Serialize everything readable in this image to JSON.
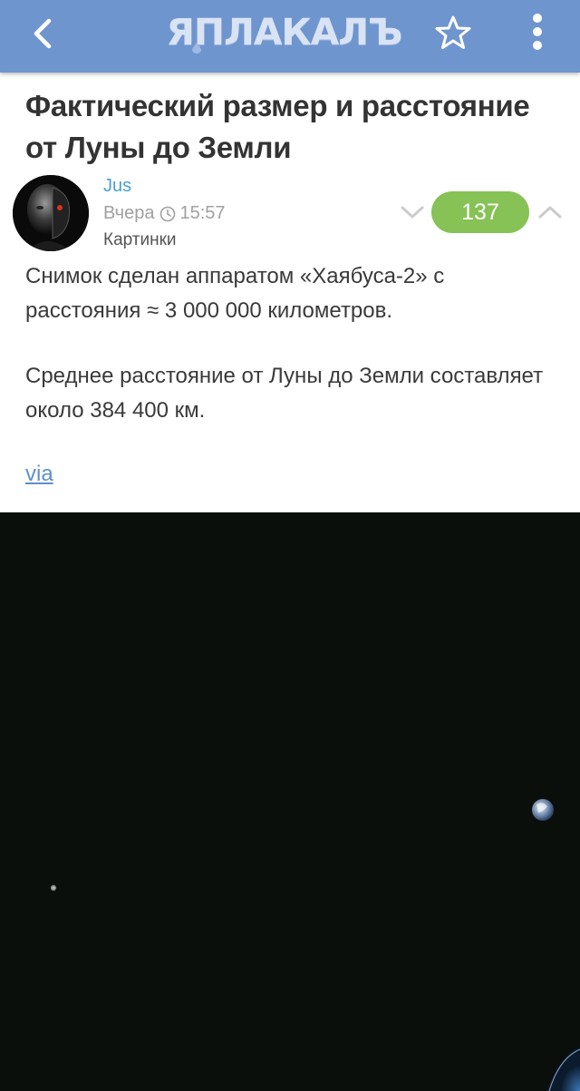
{
  "header": {
    "logo_text": "ЯПЛАКАЛЪ",
    "bar_color": "#6f95cf",
    "back_icon": "chevron-left-icon",
    "favorite_icon": "star-outline-icon",
    "menu_icon": "more-vertical-icon"
  },
  "post": {
    "title": "Фактический размер и расстояние от Луны до Земли",
    "author": "Jus",
    "date": "Вчера",
    "time": "15:57",
    "category": "Картинки",
    "rating": "137",
    "rating_color": "#86c255",
    "paragraphs": [
      "Снимок сделан аппаратом «Хаябуса-2» с расстояния ≈ 3 000 000 километров.",
      "Среднее расстояние от Луны до Земли составляет около 384 400 км."
    ],
    "via_label": "via"
  }
}
